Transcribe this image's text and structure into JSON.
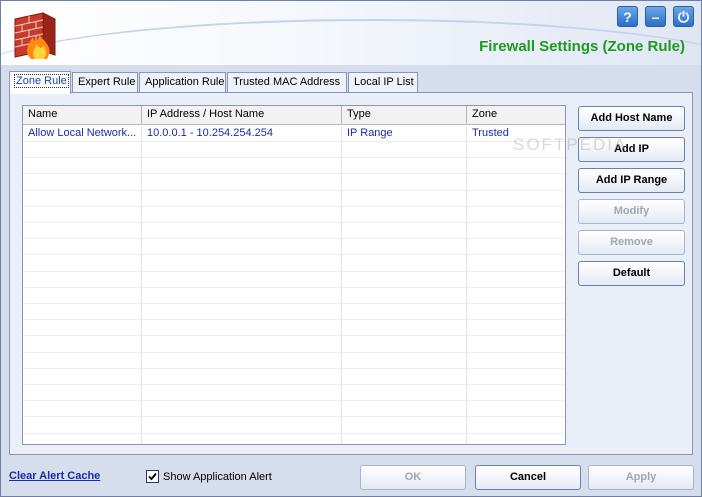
{
  "header": {
    "title": "Firewall Settings (Zone Rule)",
    "help_glyph": "?",
    "minimize_glyph": "–",
    "power_glyph": "⏻"
  },
  "tabs": [
    {
      "label": "Zone Rule",
      "active": true
    },
    {
      "label": "Expert Rule"
    },
    {
      "label": "Application Rule"
    },
    {
      "label": "Trusted MAC Address"
    },
    {
      "label": "Local IP List"
    }
  ],
  "table": {
    "columns": [
      "Name",
      "IP Address / Host Name",
      "Type",
      "Zone"
    ],
    "rows": [
      [
        "Allow Local Network...",
        "10.0.0.1 - 10.254.254.254",
        "IP Range",
        "Trusted"
      ]
    ]
  },
  "side_buttons": {
    "add_host_name": "Add Host Name",
    "add_ip": "Add IP",
    "add_ip_range": "Add IP Range",
    "modify": "Modify",
    "remove": "Remove",
    "default": "Default"
  },
  "footer": {
    "clear_alert_cache": "Clear Alert Cache",
    "show_app_alert_label": "Show Application Alert",
    "show_app_alert_checked": true,
    "ok": "OK",
    "cancel": "Cancel",
    "apply": "Apply"
  },
  "watermark": "SOFTPEDIA",
  "colors": {
    "title_green": "#1e9a1e",
    "link_blue": "#1a2aa8"
  }
}
